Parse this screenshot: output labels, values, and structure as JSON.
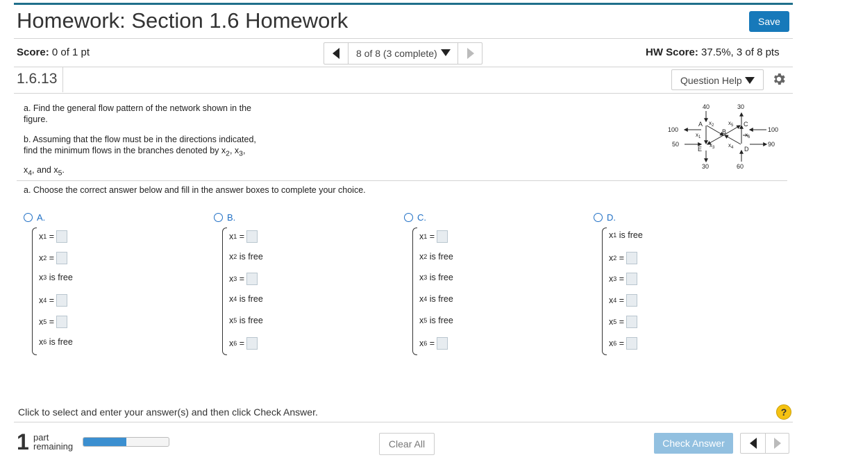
{
  "header": {
    "title": "Homework: Section 1.6 Homework",
    "save_label": "Save"
  },
  "score_bar": {
    "score_label": "Score:",
    "score_value": "0 of 1 pt",
    "nav_label": "8 of 8 (3 complete)",
    "hw_score_label": "HW Score:",
    "hw_score_value": "37.5%, 3 of 8 pts"
  },
  "question": {
    "number": "1.6.13",
    "help_label": "Question Help"
  },
  "problem": {
    "part_a_line1": "a. Find the general flow pattern of the network shown in the",
    "part_a_line2": "figure.",
    "part_b_line1": "b. Assuming that the flow must be in the directions indicated,",
    "part_b_line2": "find the minimum flows in the branches denoted by x",
    "part_b_line3": "and x"
  },
  "figure": {
    "labels": {
      "top_left": "40",
      "top_right": "30",
      "left_top": "100",
      "left_bottom": "50",
      "right_top": "100",
      "right_bottom": "90",
      "bottom_left": "30",
      "bottom_right": "60",
      "node_a": "A",
      "node_b": "B",
      "node_c": "C",
      "node_d": "D",
      "node_e": "E"
    }
  },
  "choose_text": "a. Choose the correct answer below and fill in the answer boxes to complete your choice.",
  "options": [
    {
      "letter": "A.",
      "rows": [
        {
          "var": "x",
          "sub": "1",
          "text": " =",
          "box": true
        },
        {
          "var": "x",
          "sub": "2",
          "text": " =",
          "box": true
        },
        {
          "var": "x",
          "sub": "3",
          "text": " is free",
          "box": false
        },
        {
          "var": "x",
          "sub": "4",
          "text": " =",
          "box": true
        },
        {
          "var": "x",
          "sub": "5",
          "text": " =",
          "box": true
        },
        {
          "var": "x",
          "sub": "6",
          "text": " is free",
          "box": false
        }
      ]
    },
    {
      "letter": "B.",
      "rows": [
        {
          "var": "x",
          "sub": "1",
          "text": " =",
          "box": true
        },
        {
          "var": "x",
          "sub": "2",
          "text": " is free",
          "box": false
        },
        {
          "var": "x",
          "sub": "3",
          "text": " =",
          "box": true
        },
        {
          "var": "x",
          "sub": "4",
          "text": " is free",
          "box": false
        },
        {
          "var": "x",
          "sub": "5",
          "text": " is free",
          "box": false
        },
        {
          "var": "x",
          "sub": "6",
          "text": " =",
          "box": true
        }
      ]
    },
    {
      "letter": "C.",
      "rows": [
        {
          "var": "x",
          "sub": "1",
          "text": " =",
          "box": true
        },
        {
          "var": "x",
          "sub": "2",
          "text": " is free",
          "box": false
        },
        {
          "var": "x",
          "sub": "3",
          "text": " is free",
          "box": false
        },
        {
          "var": "x",
          "sub": "4",
          "text": " is free",
          "box": false
        },
        {
          "var": "x",
          "sub": "5",
          "text": " is free",
          "box": false
        },
        {
          "var": "x",
          "sub": "6",
          "text": " =",
          "box": true
        }
      ]
    },
    {
      "letter": "D.",
      "rows": [
        {
          "var": "x",
          "sub": "1",
          "text": " is free",
          "box": false
        },
        {
          "var": "x",
          "sub": "2",
          "text": " =",
          "box": true
        },
        {
          "var": "x",
          "sub": "3",
          "text": " =",
          "box": true
        },
        {
          "var": "x",
          "sub": "4",
          "text": " =",
          "box": true
        },
        {
          "var": "x",
          "sub": "5",
          "text": " =",
          "box": true
        },
        {
          "var": "x",
          "sub": "6",
          "text": " =",
          "box": true
        }
      ]
    }
  ],
  "footer": {
    "instruction": "Click to select and enter your answer(s) and then click Check Answer.",
    "parts_count": "1",
    "parts_label_1": "part",
    "parts_label_2": "remaining",
    "progress_fraction": 0.5,
    "clear_label": "Clear All",
    "check_label": "Check Answer",
    "help_glyph": "?"
  },
  "colors": {
    "accent": "#1779ba",
    "topbar": "#1f6f8b",
    "link": "#1f6fc5",
    "check_disabled": "#92c0e0",
    "help": "#f5c211"
  },
  "icons": {
    "gear": "gear-icon",
    "help": "help-icon",
    "prev": "triangle-left-icon",
    "next": "triangle-right-icon",
    "dropdown": "caret-down-icon"
  }
}
